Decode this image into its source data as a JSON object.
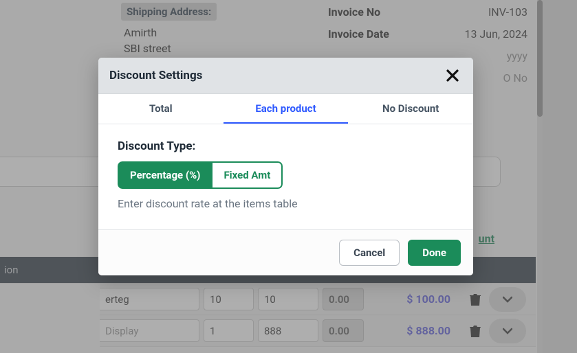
{
  "background": {
    "shipping_label": "Shipping Address:",
    "shipping_name": "Amirth",
    "shipping_line2": "SBI street",
    "invoice_no_label": "Invoice No",
    "invoice_no_value": "INV-103",
    "invoice_date_label": "Invoice Date",
    "invoice_date_value": "13 Jun, 2024",
    "date_placeholder": "yyyy",
    "po_placeholder": "O No",
    "table_header_fragment": "ion",
    "discount_link_fragment": "unt",
    "rows": [
      {
        "desc": "erteg",
        "is_placeholder": false,
        "qty": "10",
        "rate": "10",
        "disc": "0.00",
        "amount": "$ 100.00"
      },
      {
        "desc": "Display",
        "is_placeholder": true,
        "qty": "1",
        "rate": "888",
        "disc": "0.00",
        "amount": "$ 888.00"
      }
    ]
  },
  "modal": {
    "title": "Discount Settings",
    "tabs": {
      "total": "Total",
      "each_product": "Each product",
      "no_discount": "No Discount"
    },
    "discount_type_label": "Discount Type:",
    "percentage_label": "Percentage (%)",
    "fixed_label": "Fixed Amt",
    "hint": "Enter discount rate at the items table",
    "cancel": "Cancel",
    "done": "Done"
  }
}
